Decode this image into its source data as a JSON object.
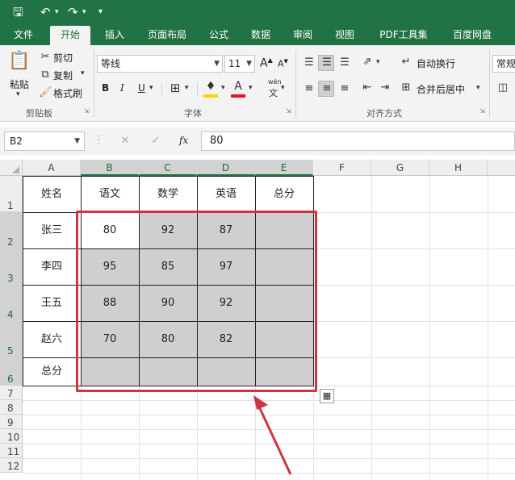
{
  "quick_access": {
    "save_icon": "save-icon",
    "undo_icon": "undo-icon",
    "redo_icon": "redo-icon",
    "customize_icon": "customize-icon"
  },
  "tabs": [
    "文件",
    "开始",
    "插入",
    "页面布局",
    "公式",
    "数据",
    "审阅",
    "视图",
    "PDF工具集",
    "百度网盘"
  ],
  "active_tab": "开始",
  "clipboard": {
    "paste": "粘贴",
    "cut": "剪切",
    "copy": "复制",
    "format_painter": "格式刷",
    "group": "剪贴板"
  },
  "font": {
    "name": "等线",
    "size": "11",
    "grow": "A",
    "shrink": "A",
    "bold": "B",
    "italic": "I",
    "underline": "U",
    "wen": "wén",
    "wen_char": "文",
    "group": "字体"
  },
  "alignment": {
    "wrap_text": "自动换行",
    "merge_center": "合并后居中",
    "group": "对齐方式"
  },
  "number": {
    "format": "常规"
  },
  "formula_bar": {
    "name_box": "B2",
    "fx": "fx",
    "value": "80"
  },
  "columns": [
    "A",
    "B",
    "C",
    "D",
    "E",
    "F",
    "G",
    "H"
  ],
  "rows": [
    "1",
    "2",
    "3",
    "4",
    "5",
    "6",
    "7",
    "8",
    "9",
    "10",
    "11",
    "12"
  ],
  "table": {
    "headers": [
      "姓名",
      "语文",
      "数学",
      "英语",
      "总分"
    ],
    "rows": [
      [
        "张三",
        "80",
        "92",
        "87",
        ""
      ],
      [
        "李四",
        "95",
        "85",
        "97",
        ""
      ],
      [
        "王五",
        "88",
        "90",
        "92",
        ""
      ],
      [
        "赵六",
        "70",
        "80",
        "82",
        ""
      ],
      [
        "总分",
        "",
        "",
        "",
        ""
      ]
    ]
  },
  "colors": {
    "excel_green": "#217346",
    "selection_gray": "#cfcfcf",
    "annotation_red": "#d0343e"
  }
}
